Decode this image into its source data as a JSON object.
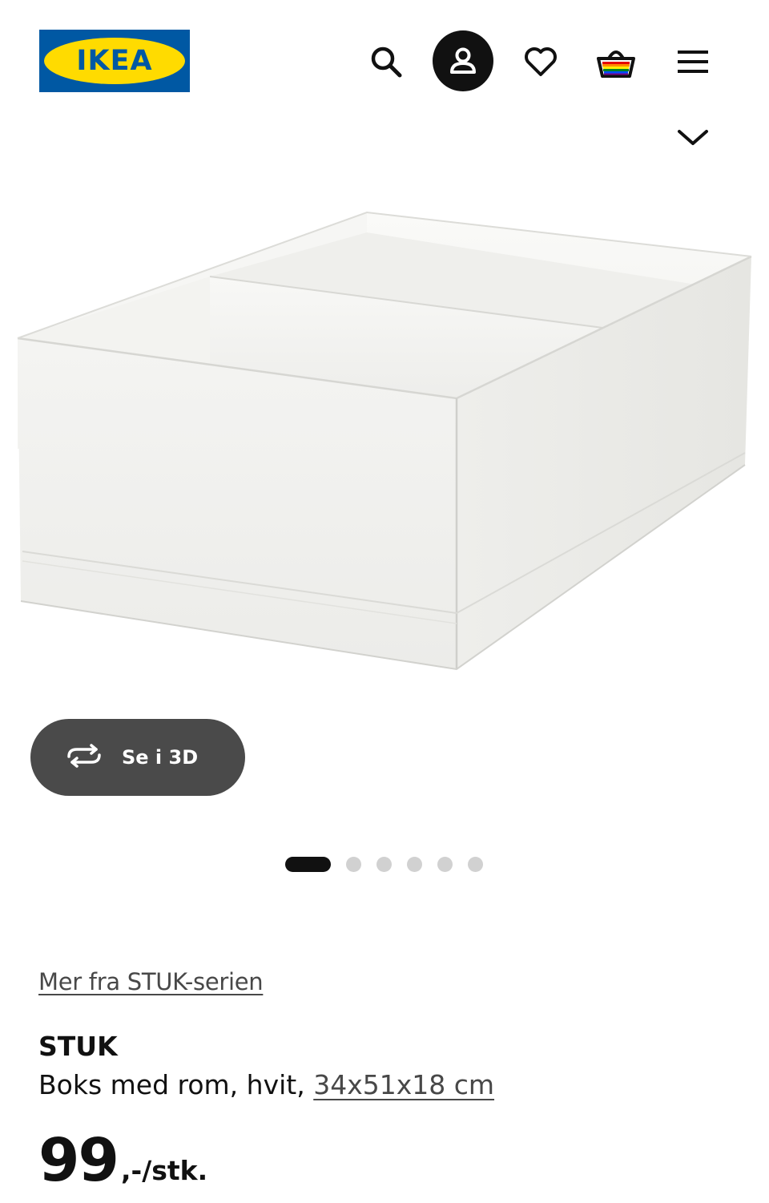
{
  "header": {
    "logo_text": "IKEA",
    "icons": [
      "search-icon",
      "account-icon",
      "heart-icon",
      "cart-icon",
      "menu-icon"
    ],
    "colors": {
      "brand_blue": "#0058a3",
      "brand_yellow": "#ffdb00"
    }
  },
  "gallery": {
    "view_3d_label": "Se i 3D",
    "dots_total": 6,
    "active_dot": 1
  },
  "product": {
    "series_link": "Mer fra STUK-serien",
    "name": "STUK",
    "description": "Boks med rom, hvit,",
    "dimensions": "34x51x18 cm",
    "price_integer": "99",
    "price_suffix": ",-/stk."
  }
}
